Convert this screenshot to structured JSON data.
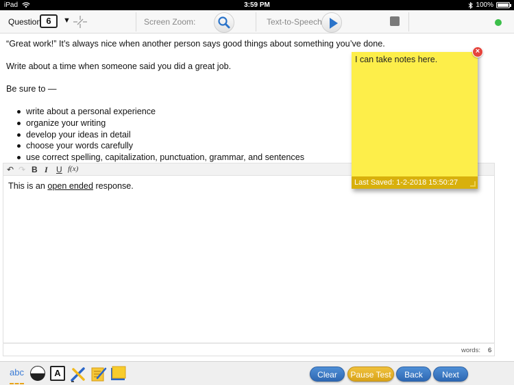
{
  "status_bar": {
    "device": "iPad",
    "time": "3:59 PM",
    "battery_text": "100%",
    "battery_level": 1.0
  },
  "toolbar": {
    "question_label": "Question",
    "question_number": "6",
    "zoom_label": "Screen Zoom:",
    "tts_label": "Text-to-Speech",
    "status_color": "#3cbf4a"
  },
  "passage": {
    "intro": "“Great work!” It’s always nice when another person says good things about something you’ve done.",
    "prompt": "Write about a time when someone said you did a great job.",
    "be_sure": "Be sure to —",
    "bullets": [
      "write about a personal experience",
      "organize your writing",
      "develop your ideas in detail",
      "choose your words carefully",
      "use correct spelling, capitalization, punctuation, grammar, and sentences"
    ]
  },
  "editor": {
    "toolbar": {
      "bold": "B",
      "italic": "I",
      "underline": "U",
      "formula": "f(x)"
    },
    "text_before": "This is an ",
    "text_underlined": "open ended",
    "text_after": " response.",
    "words_label": "words:",
    "words_count": "6"
  },
  "sticky_note": {
    "text": "I can take notes here.",
    "last_saved": "Last Saved: 1-2-2018 15:50:27",
    "close_symbol": "×",
    "color": "#fdee4a"
  },
  "bottom_bar": {
    "spell_label": "abc",
    "font_label": "A",
    "tools": [
      "spellcheck-icon",
      "contrast-icon",
      "font-size-icon",
      "highlighter-icon",
      "notepad-icon",
      "sticky-note-icon"
    ],
    "buttons": {
      "clear": "Clear",
      "pause": "Pause Test",
      "back": "Back",
      "next": "Next"
    }
  }
}
